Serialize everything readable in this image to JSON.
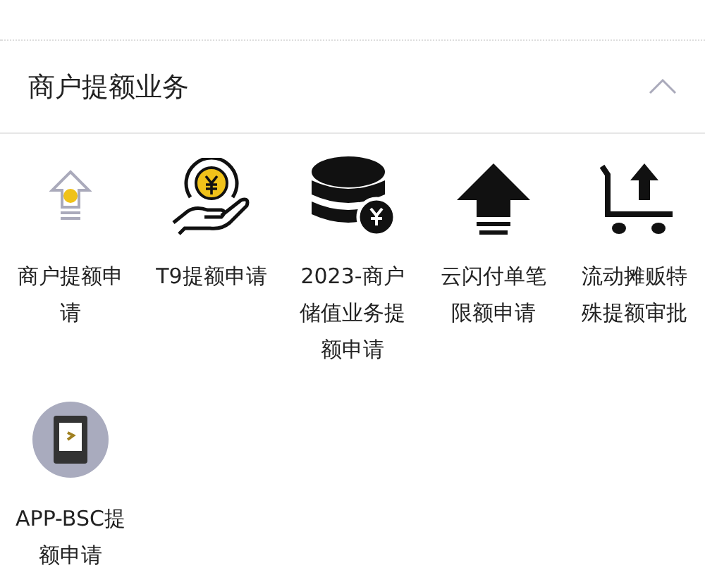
{
  "section": {
    "title": "商户提额业务",
    "expanded": true
  },
  "items": [
    {
      "label": "商户提额申请"
    },
    {
      "label": "T9提额申请"
    },
    {
      "label": "2023-商户储值业务提额申请"
    },
    {
      "label": "云闪付单笔限额申请"
    },
    {
      "label": "流动摊贩特殊提额审批"
    },
    {
      "label": "APP-BSC提额申请"
    }
  ]
}
